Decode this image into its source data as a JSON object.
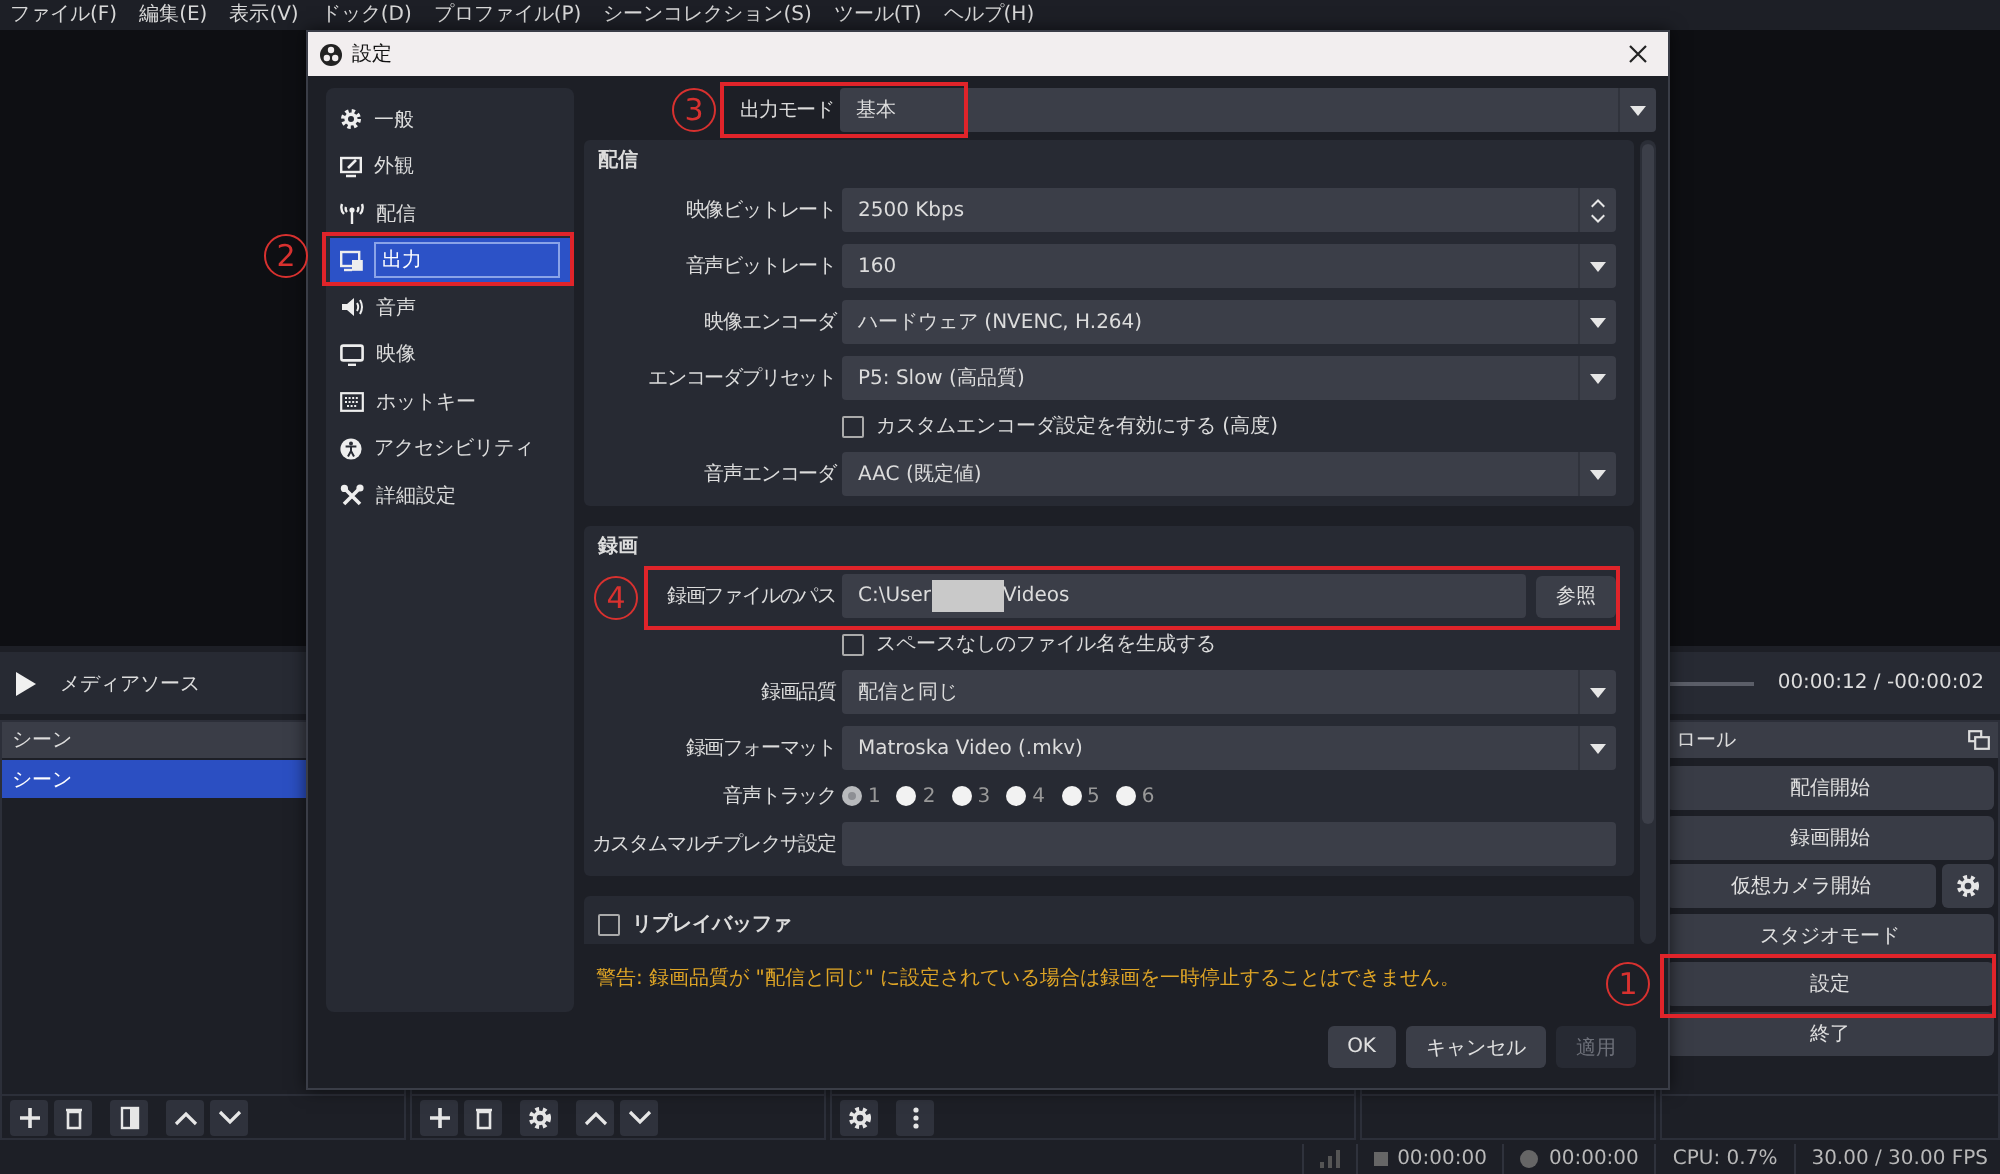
{
  "menu": [
    "ファイル(F)",
    "編集(E)",
    "表示(V)",
    "ドック(D)",
    "プロファイル(P)",
    "シーンコレクション(S)",
    "ツール(T)",
    "ヘルプ(H)"
  ],
  "media_bar": {
    "title": "メディアソース",
    "time": "00:00:12 / -00:00:02"
  },
  "scenes_dock": {
    "title": "シーン",
    "items": [
      {
        "label": "シーン",
        "selected": true
      }
    ]
  },
  "controls_dock": {
    "title": "ロール",
    "buttons": [
      {
        "label": "配信開始",
        "kind": "plain"
      },
      {
        "label": "録画開始",
        "kind": "plain"
      },
      {
        "label": "仮想カメラ開始",
        "kind": "with-settings"
      },
      {
        "label": "スタジオモード",
        "kind": "plain"
      },
      {
        "label": "設定",
        "kind": "plain"
      },
      {
        "label": "終了",
        "kind": "plain"
      }
    ]
  },
  "status_bar": {
    "recording_time": "00:00:00",
    "streaming_time": "00:00:00",
    "cpu": "CPU: 0.7%",
    "fps": "30.00 / 30.00 FPS"
  },
  "dialog": {
    "title": "設定",
    "sidebar": [
      {
        "label": "一般",
        "selected": false
      },
      {
        "label": "外観",
        "selected": false
      },
      {
        "label": "配信",
        "selected": false
      },
      {
        "label": "出力",
        "selected": true
      },
      {
        "label": "音声",
        "selected": false
      },
      {
        "label": "映像",
        "selected": false
      },
      {
        "label": "ホットキー",
        "selected": false
      },
      {
        "label": "アクセシビリティ",
        "selected": false
      },
      {
        "label": "詳細設定",
        "selected": false
      }
    ],
    "output_mode": {
      "label": "出力モード",
      "value": "基本"
    },
    "sections": [
      {
        "title": "配信",
        "rows": [
          {
            "kind": "spin",
            "label": "映像ビットレート",
            "value": "2500 Kbps"
          },
          {
            "kind": "combo",
            "label": "音声ビットレート",
            "value": "160"
          },
          {
            "kind": "combo",
            "label": "映像エンコーダ",
            "value": "ハードウェア (NVENC, H.264)"
          },
          {
            "kind": "combo",
            "label": "エンコーダプリセット",
            "value": "P5: Slow (高品質)"
          },
          {
            "kind": "checkbox",
            "label": "カスタムエンコーダ設定を有効にする (高度)",
            "checked": false
          },
          {
            "kind": "combo",
            "label": "音声エンコーダ",
            "value": "AAC (既定値)"
          }
        ]
      },
      {
        "title": "録画",
        "rows": [
          {
            "kind": "path",
            "label": "録画ファイルのパス",
            "value_start": "C:\\User",
            "value_end": "Videos",
            "button": "参照"
          },
          {
            "kind": "checkbox",
            "label": "スペースなしのファイル名を生成する",
            "checked": false
          },
          {
            "kind": "combo",
            "label": "録画品質",
            "value": "配信と同じ"
          },
          {
            "kind": "combo",
            "label": "録画フォーマット",
            "value": "Matroska Video (.mkv)"
          },
          {
            "kind": "radio",
            "label": "音声トラック",
            "options": [
              {
                "label": "1",
                "selected": true
              },
              {
                "label": "2",
                "selected": false
              },
              {
                "label": "3",
                "selected": false
              },
              {
                "label": "4",
                "selected": false
              },
              {
                "label": "5",
                "selected": false
              },
              {
                "label": "6",
                "selected": false
              }
            ]
          },
          {
            "kind": "text",
            "label": "カスタムマルチプレクサ設定"
          }
        ]
      }
    ],
    "replay_buffer": {
      "label": "リプレイバッファ",
      "checked": false
    },
    "warning": "警告: 録画品質が \"配信と同じ\" に設定されている場合は録画を一時停止することはできません。",
    "buttons": [
      {
        "label": "OK",
        "disabled": false
      },
      {
        "label": "キャンセル",
        "disabled": false
      },
      {
        "label": "適用",
        "disabled": true
      }
    ]
  },
  "annotations": [
    {
      "number": "1"
    },
    {
      "number": "2"
    },
    {
      "number": "3"
    },
    {
      "number": "4"
    }
  ]
}
